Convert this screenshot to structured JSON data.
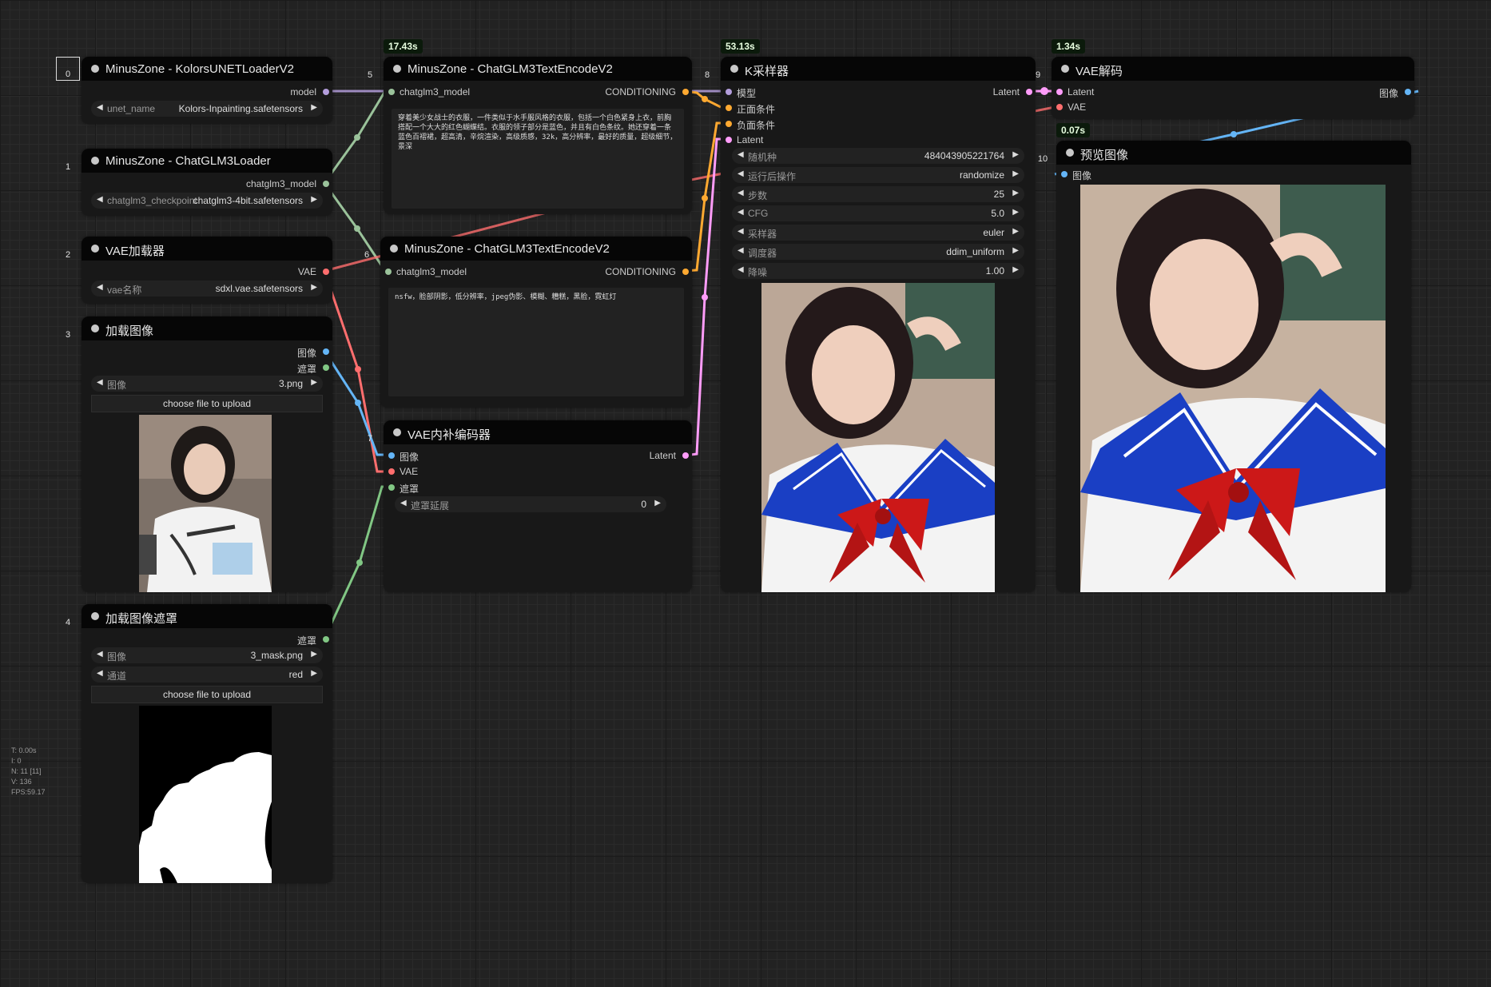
{
  "colors": {
    "model": "#b39ddb",
    "clip": "#9ac29a",
    "conditioning": "#ffa931",
    "latent": "#ff9cf9",
    "vae": "#ff6e6e",
    "image": "#64b5f6",
    "mask": "#81c784"
  },
  "nodes": [
    {
      "id": "0",
      "title": "MinusZone - KolorsUNETLoaderV2",
      "outputs": [
        "model"
      ],
      "widgets": [
        {
          "name": "unet_name",
          "value": "Kolors-Inpainting.safetensors"
        }
      ]
    },
    {
      "id": "1",
      "title": "MinusZone - ChatGLM3Loader",
      "outputs": [
        "chatglm3_model"
      ],
      "widgets": [
        {
          "name": "chatglm3_checkpoint",
          "value": "chatglm3-4bit.safetensors"
        }
      ]
    },
    {
      "id": "2",
      "title": "VAE加载器",
      "outputs": [
        "VAE"
      ],
      "widgets": [
        {
          "name": "vae名称",
          "value": "sdxl.vae.safetensors"
        }
      ]
    },
    {
      "id": "3",
      "title": "加载图像",
      "outputs": [
        "图像",
        "遮罩"
      ],
      "widgets": [
        {
          "name": "图像",
          "value": "3.png"
        }
      ],
      "upload": "choose file to upload",
      "image": "photo of woman in white t-shirt"
    },
    {
      "id": "4",
      "title": "加载图像遮罩",
      "outputs": [
        "遮罩"
      ],
      "widgets": [
        {
          "name": "图像",
          "value": "3_mask.png"
        },
        {
          "name": "通道",
          "value": "red"
        }
      ],
      "upload": "choose file to upload",
      "image": "mask image"
    },
    {
      "id": "5",
      "title": "MinusZone - ChatGLM3TextEncodeV2",
      "timing": "17.43s",
      "inputs": [
        "chatglm3_model"
      ],
      "outputs": [
        "CONDITIONING"
      ],
      "text": "穿着美少女战士的衣服，一件类似于水手服风格的衣服，包括一个白色紧身上衣，前胸搭配一个大大的红色蝴蝶结。衣服的领子部分是蓝色，并且有白色条纹。她还穿着一条蓝色百褶裙，超高清，辛烷渲染，高级质感，32k，高分辨率，最好的质量，超级细节，景深"
    },
    {
      "id": "6",
      "title": "MinusZone - ChatGLM3TextEncodeV2",
      "inputs": [
        "chatglm3_model"
      ],
      "outputs": [
        "CONDITIONING"
      ],
      "text": "nsfw，脸部阴影，低分辨率，jpeg伪影、模糊、糟糕，黑脸，霓虹灯"
    },
    {
      "id": "7",
      "title": "VAE内补编码器",
      "inputs": [
        "图像",
        "VAE",
        "遮罩"
      ],
      "outputs": [
        "Latent"
      ],
      "widgets": [
        {
          "name": "遮罩延展",
          "value": "0"
        }
      ]
    },
    {
      "id": "8",
      "title": "K采样器",
      "timing": "53.13s",
      "inputs": [
        "模型",
        "正面条件",
        "负面条件",
        "Latent"
      ],
      "outputs": [
        "Latent"
      ],
      "widgets": [
        {
          "name": "随机种",
          "value": "484043905221764"
        },
        {
          "name": "运行后操作",
          "value": "randomize"
        },
        {
          "name": "步数",
          "value": "25"
        },
        {
          "name": "CFG",
          "value": "5.0"
        },
        {
          "name": "采样器",
          "value": "euler"
        },
        {
          "name": "调度器",
          "value": "ddim_uniform"
        },
        {
          "name": "降噪",
          "value": "1.00"
        }
      ],
      "image": "sailor uniform preview"
    },
    {
      "id": "9",
      "title": "VAE解码",
      "timing": "1.34s",
      "inputs": [
        "Latent",
        "VAE"
      ],
      "outputs": [
        "图像"
      ]
    },
    {
      "id": "10",
      "title": "预览图像",
      "timing": "0.07s",
      "inputs": [
        "图像"
      ],
      "image": "sailor uniform output"
    }
  ],
  "stats": [
    "T: 0.00s",
    "I: 0",
    "N: 11 [11]",
    "V: 136",
    "FPS:59.17"
  ]
}
